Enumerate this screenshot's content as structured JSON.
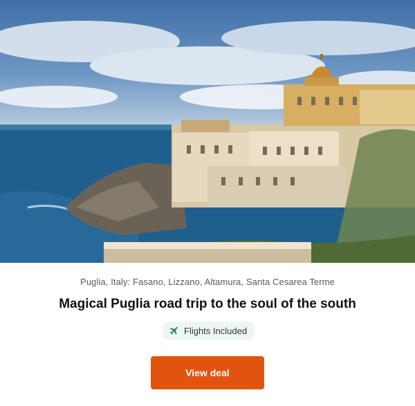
{
  "deal": {
    "location": "Puglia, Italy: Fasano, Lizzano, Altamura, Santa Cesarea Terme",
    "title": "Magical Puglia road trip to the soul of the south",
    "badge": {
      "label": "Flights Included",
      "icon": "airplane-icon",
      "icon_color": "#1f8a5a"
    },
    "cta_label": "View deal",
    "cta_color": "#e2530f"
  },
  "hero": {
    "alt": "Coastal town with ornate domed villa above the sea"
  }
}
